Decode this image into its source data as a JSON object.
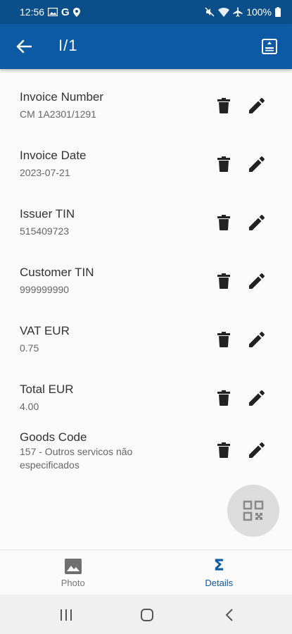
{
  "status_bar": {
    "time": "12:56",
    "battery": "100%"
  },
  "app_bar": {
    "title": "I/1"
  },
  "fields": [
    {
      "label": "Invoice Number",
      "value": "CM 1A2301/1291"
    },
    {
      "label": "Invoice Date",
      "value": "2023-07-21"
    },
    {
      "label": "Issuer TIN",
      "value": "515409723"
    },
    {
      "label": "Customer TIN",
      "value": "999999990"
    },
    {
      "label": "VAT EUR",
      "value": "0.75"
    },
    {
      "label": "Total EUR",
      "value": "4.00"
    },
    {
      "label": "Goods Code",
      "value": "157 - Outros servicos não especificados"
    }
  ],
  "bottom_nav": {
    "photo_label": "Photo",
    "details_label": "Details",
    "active": "details"
  },
  "colors": {
    "app_bar": "#0b5aa3",
    "status_bar": "#0b4f8a",
    "accent": "#0b5aa3"
  },
  "icons": {
    "back": "arrow-left-icon",
    "export": "export-icon",
    "delete": "trash-icon",
    "edit": "pencil-icon",
    "fab": "qr-code-icon",
    "photo": "image-icon",
    "details": "sigma-icon"
  }
}
